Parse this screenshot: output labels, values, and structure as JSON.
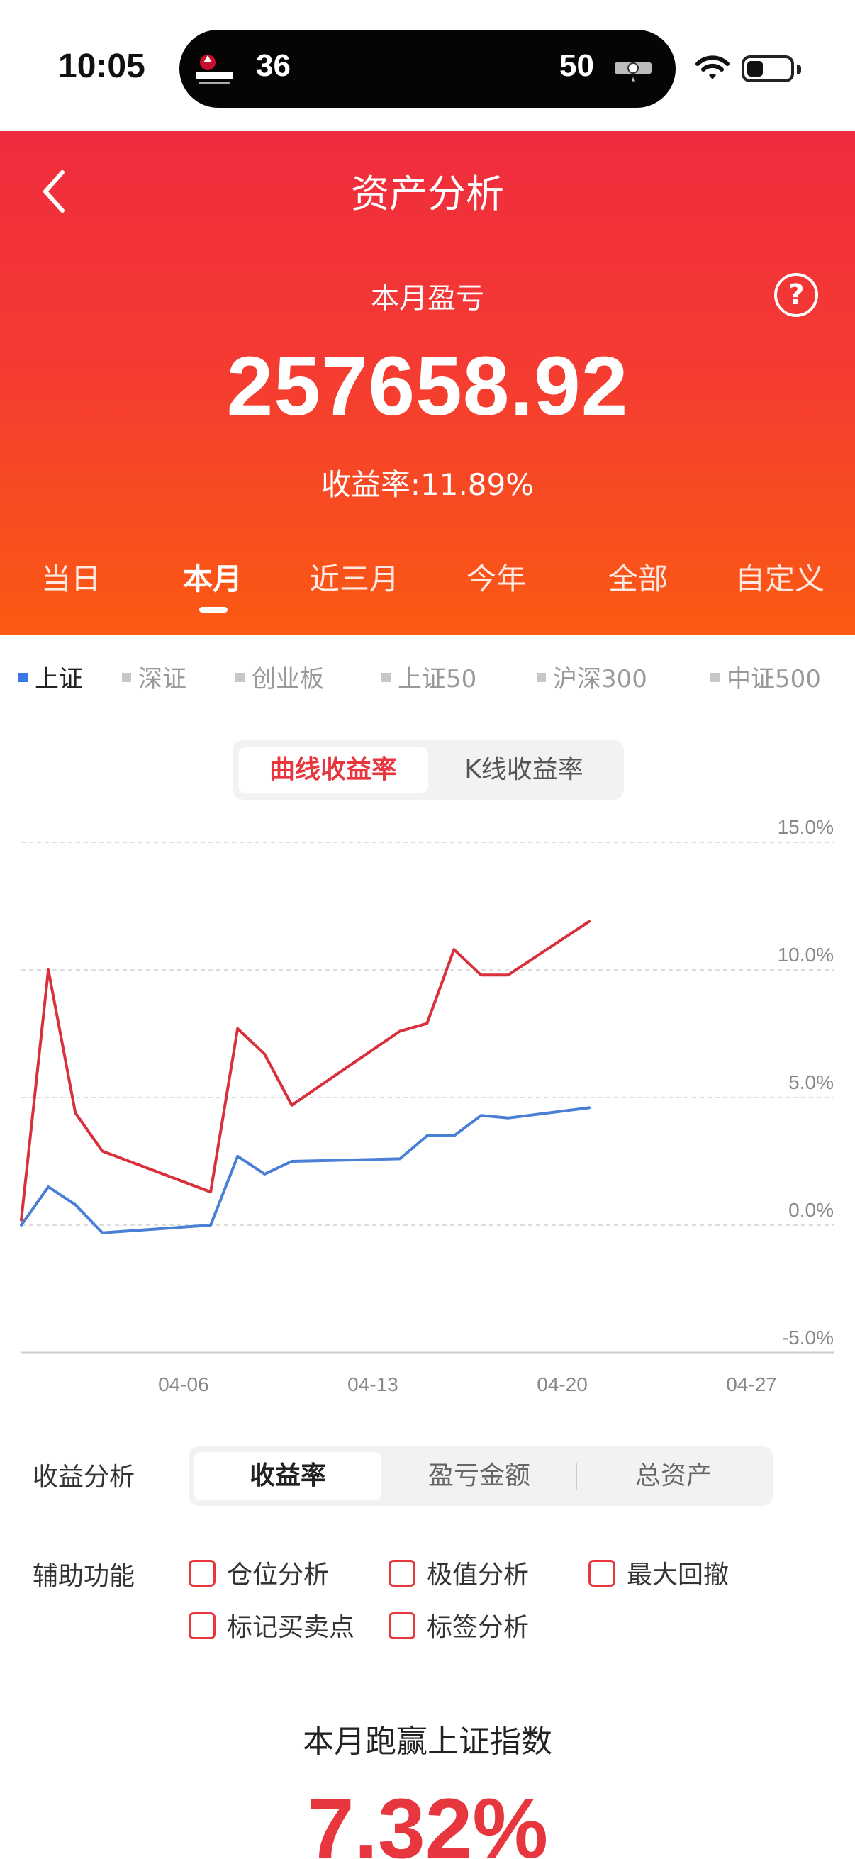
{
  "status_bar": {
    "time": "10:05",
    "live_activity": {
      "left_team_logo": "portland-logo",
      "left_score": "36",
      "right_score": "50",
      "right_team_logo": "spurs-logo"
    },
    "icons": [
      "wifi-icon",
      "battery-icon"
    ]
  },
  "header": {
    "title": "资产分析",
    "back_icon": "chevron-left-icon",
    "help_icon": "question-icon",
    "help_text": "?",
    "month_label": "本月盈亏",
    "amount": "257658.92",
    "rate": "收益率:11.89%",
    "colors": {
      "top": "#ef2c3e",
      "bottom": "#fb5a12"
    }
  },
  "period_tabs": [
    {
      "label": "当日",
      "active": false
    },
    {
      "label": "本月",
      "active": true
    },
    {
      "label": "近三月",
      "active": false
    },
    {
      "label": "今年",
      "active": false
    },
    {
      "label": "全部",
      "active": false
    },
    {
      "label": "自定义",
      "active": false
    }
  ],
  "index_tabs": [
    {
      "label": "上证",
      "active": true
    },
    {
      "label": "深证",
      "active": false
    },
    {
      "label": "创业板",
      "active": false
    },
    {
      "label": "上证50",
      "active": false
    },
    {
      "label": "沪深300",
      "active": false
    },
    {
      "label": "中证500",
      "active": false
    }
  ],
  "chart_toggle": {
    "active": "曲线收益率",
    "inactive": "K线收益率"
  },
  "chart_data": {
    "type": "line",
    "x_tick_labels": [
      "04-06",
      "04-13",
      "04-20",
      "04-27"
    ],
    "y_tick_labels": [
      "15.0%",
      "10.0%",
      "5.0%",
      "0.0%",
      "-5.0%"
    ],
    "ylim": [
      -5,
      15
    ],
    "grid": true,
    "series": [
      {
        "color": "#d8313c",
        "points": [
          [
            "03-31",
            0.2
          ],
          [
            "04-01",
            10.0
          ],
          [
            "04-02",
            4.4
          ],
          [
            "04-03",
            2.9
          ],
          [
            "04-07",
            1.3
          ],
          [
            "04-08",
            7.7
          ],
          [
            "04-09",
            6.7
          ],
          [
            "04-10",
            4.7
          ],
          [
            "04-14",
            7.6
          ],
          [
            "04-15",
            7.9
          ],
          [
            "04-16",
            10.8
          ],
          [
            "04-17",
            9.8
          ],
          [
            "04-18",
            9.8
          ],
          [
            "04-21",
            11.9
          ]
        ]
      },
      {
        "color": "#4a7fd6",
        "points": [
          [
            "03-31",
            0.0
          ],
          [
            "04-01",
            1.5
          ],
          [
            "04-02",
            0.8
          ],
          [
            "04-03",
            -0.3
          ],
          [
            "04-07",
            0.0
          ],
          [
            "04-08",
            2.7
          ],
          [
            "04-09",
            2.0
          ],
          [
            "04-10",
            2.5
          ],
          [
            "04-14",
            2.6
          ],
          [
            "04-15",
            3.5
          ],
          [
            "04-16",
            3.5
          ],
          [
            "04-17",
            4.3
          ],
          [
            "04-18",
            4.2
          ],
          [
            "04-21",
            4.6
          ]
        ]
      }
    ]
  },
  "analysis": {
    "label": "收益分析",
    "options": [
      {
        "label": "收益率",
        "active": true
      },
      {
        "label": "盈亏金额",
        "active": false
      },
      {
        "label": "总资产",
        "active": false
      }
    ]
  },
  "aux": {
    "label": "辅助功能",
    "options": [
      "仓位分析",
      "极值分析",
      "最大回撤",
      "标记买卖点",
      "标签分析"
    ]
  },
  "beat": {
    "title": "本月跑赢上证指数",
    "value": "7.32%"
  }
}
